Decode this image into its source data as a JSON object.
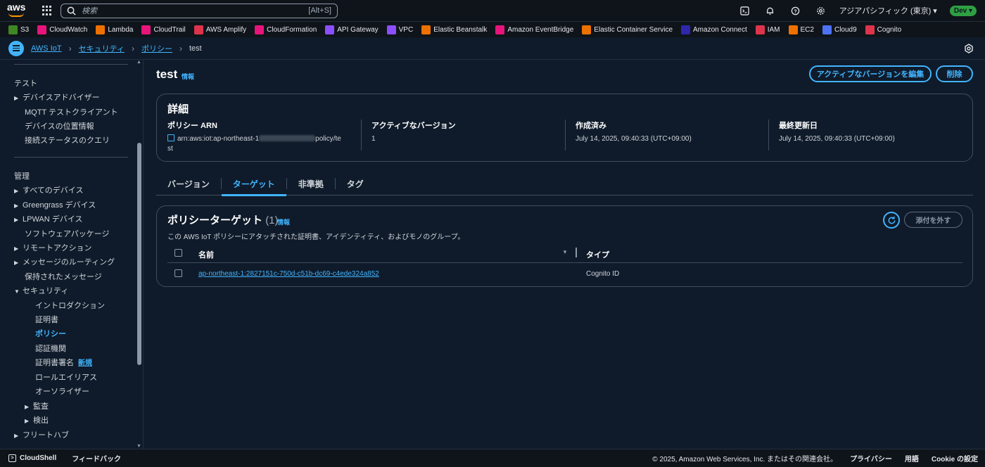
{
  "topnav": {
    "logo": "aws",
    "search_placeholder": "検索",
    "search_shortcut": "[Alt+S]",
    "region": "アジアパシフィック (東京) ▾",
    "env_badge": "Dev ▾"
  },
  "favorites": [
    {
      "label": "S3",
      "color": "#3f8624"
    },
    {
      "label": "CloudWatch",
      "color": "#e7157b"
    },
    {
      "label": "Lambda",
      "color": "#ed7100"
    },
    {
      "label": "CloudTrail",
      "color": "#e7157b"
    },
    {
      "label": "AWS Amplify",
      "color": "#dd344c"
    },
    {
      "label": "CloudFormation",
      "color": "#e7157b"
    },
    {
      "label": "API Gateway",
      "color": "#8c4fff"
    },
    {
      "label": "VPC",
      "color": "#8c4fff"
    },
    {
      "label": "Elastic Beanstalk",
      "color": "#ed7100"
    },
    {
      "label": "Amazon EventBridge",
      "color": "#e7157b"
    },
    {
      "label": "Elastic Container Service",
      "color": "#ed7100"
    },
    {
      "label": "Amazon Connect",
      "color": "#2e27ad"
    },
    {
      "label": "IAM",
      "color": "#dd344c"
    },
    {
      "label": "EC2",
      "color": "#ed7100"
    },
    {
      "label": "Cloud9",
      "color": "#4d72f3"
    },
    {
      "label": "Cognito",
      "color": "#dd344c"
    }
  ],
  "breadcrumb": {
    "items": [
      "AWS IoT",
      "セキュリティ",
      "ポリシー"
    ],
    "current": "test"
  },
  "sidebar": {
    "test_header": "テスト",
    "test_items": [
      "デバイスアドバイザー",
      "MQTT テストクライアント",
      "デバイスの位置情報",
      "接続ステータスのクエリ"
    ],
    "manage_header": "管理",
    "manage_items": [
      "すべてのデバイス",
      "Greengrass デバイス",
      "LPWAN デバイス",
      "ソフトウェアパッケージ",
      "リモートアクション",
      "メッセージのルーティング",
      "保持されたメッセージ",
      "セキュリティ"
    ],
    "security_items": [
      "イントロダクション",
      "証明書",
      "ポリシー",
      "認証機関",
      "証明書署名",
      "ロールエイリアス",
      "オーソライザー"
    ],
    "new_badge": "新規",
    "sub_items": [
      "監査",
      "検出"
    ],
    "fleet_hub": "フリートハブ"
  },
  "page": {
    "title": "test",
    "info": "情報",
    "edit_button": "アクティブなバージョンを編集",
    "delete_button": "削除"
  },
  "details": {
    "heading": "詳細",
    "arn_label": "ポリシー ARN",
    "arn_prefix": "arn:aws:iot:ap-northeast-1",
    "arn_suffix": "policy/te",
    "arn_wrap": "st",
    "active_version_label": "アクティブなバージョン",
    "active_version": "1",
    "created_label": "作成済み",
    "created": "July 14, 2025, 09:40:33 (UTC+09:00)",
    "updated_label": "最終更新日",
    "updated": "July 14, 2025, 09:40:33 (UTC+09:00)"
  },
  "tabs": [
    "バージョン",
    "ターゲット",
    "非準拠",
    "タグ"
  ],
  "targets": {
    "title": "ポリシーターゲット",
    "count": "(1)",
    "info": "情報",
    "description": "この AWS IoT ポリシーにアタッチされた証明書、アイデンティティ、およびモノのグループ。",
    "detach_button": "添付を外す",
    "columns": [
      "名前",
      "タイプ"
    ],
    "rows": [
      {
        "name": "ap-northeast-1:2827151c-750d-c51b-dc69-c4ede324a852",
        "type": "Cognito ID"
      }
    ]
  },
  "footer": {
    "cloudshell": "CloudShell",
    "feedback": "フィードバック",
    "copyright": "© 2025, Amazon Web Services, Inc. またはその関連会社。",
    "privacy": "プライバシー",
    "terms": "用語",
    "cookie": "Cookie の設定"
  },
  "colors": {
    "accent": "#42b4ff",
    "background": "#0f1b2a",
    "nav_background": "#0f141a"
  }
}
